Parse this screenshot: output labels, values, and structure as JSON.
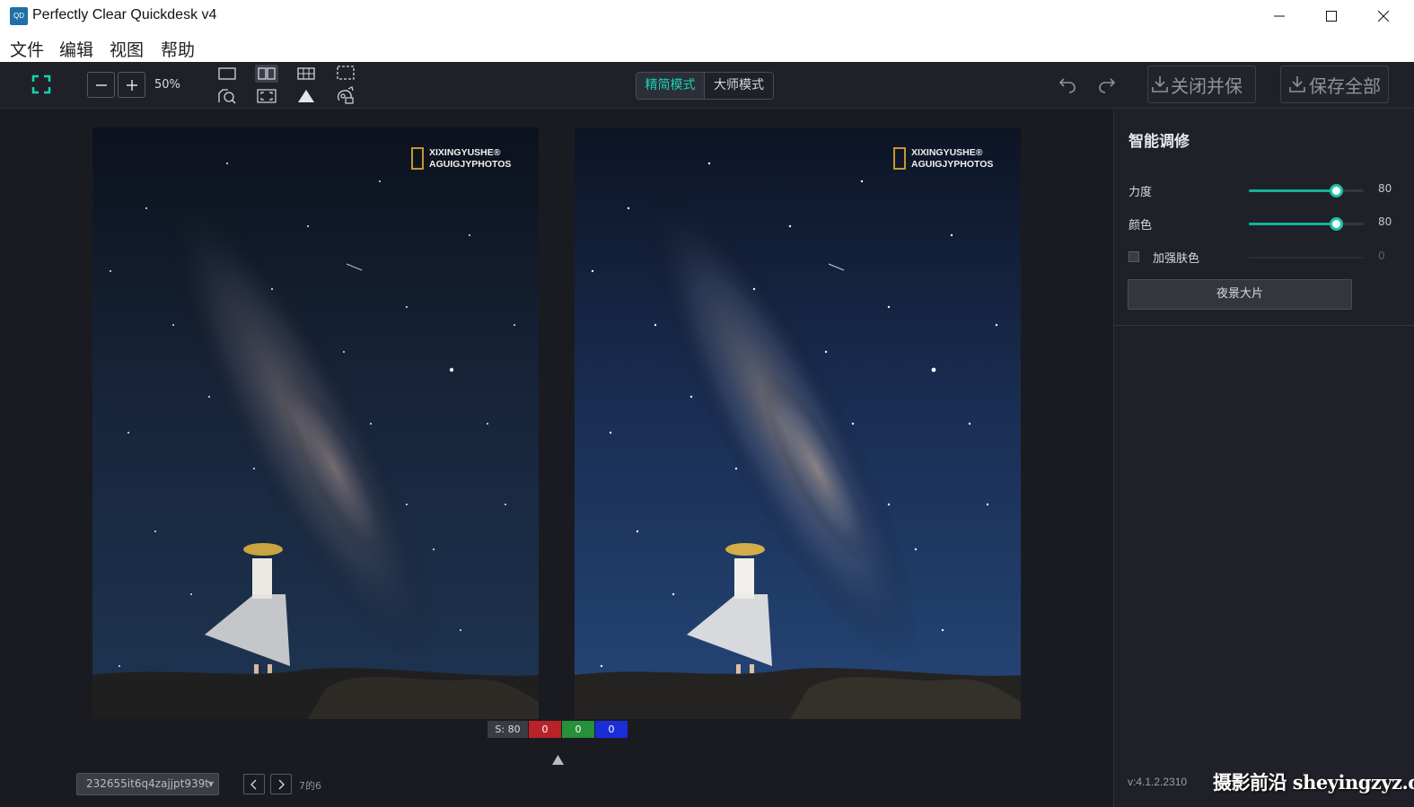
{
  "window": {
    "title": "Perfectly Clear Quickdesk v4",
    "icon_text": "QD",
    "controls": [
      "minimize-icon",
      "maximize-icon",
      "close-icon"
    ]
  },
  "menu": [
    "文件",
    "编辑",
    "视图",
    "帮助"
  ],
  "toolbar": {
    "zoom": "50%",
    "view_icons": [
      "single-view-icon",
      "split-view-icon",
      "grid-view-icon",
      "crop-select-icon",
      "magnifier-compare-icon",
      "fit-screen-icon",
      "triangle-icon",
      "image-edit-icon"
    ],
    "modes": {
      "simple": "精简模式",
      "master": "大师模式",
      "active": "simple"
    },
    "save_close": "关闭并保",
    "save_all": "保存全部"
  },
  "watermark": {
    "line1": "XIXINGYUSHE®",
    "line2": "AGUIGJYPHOTOS"
  },
  "channels": {
    "s": "S: 80",
    "r": "0",
    "g": "0",
    "b": "0"
  },
  "bottom": {
    "file_name": "232655it6q4zajjpt939t",
    "page": "7的6"
  },
  "panel": {
    "title": "智能调修",
    "sliders": [
      {
        "label": "力度",
        "value": "80",
        "fraction": 0.76
      },
      {
        "label": "颜色",
        "value": "80",
        "fraction": 0.76
      }
    ],
    "skin": {
      "label": "加强肤色",
      "value": "0",
      "checked": false
    },
    "preset": "夜景大片",
    "version": "v:4.1.2.2310",
    "site_watermark": "摄影前沿 sheyingzyz.com"
  },
  "colors": {
    "accent": "#1bd1b2",
    "toolbar_bg": "#202128",
    "canvas_bg": "#1a1b21"
  }
}
